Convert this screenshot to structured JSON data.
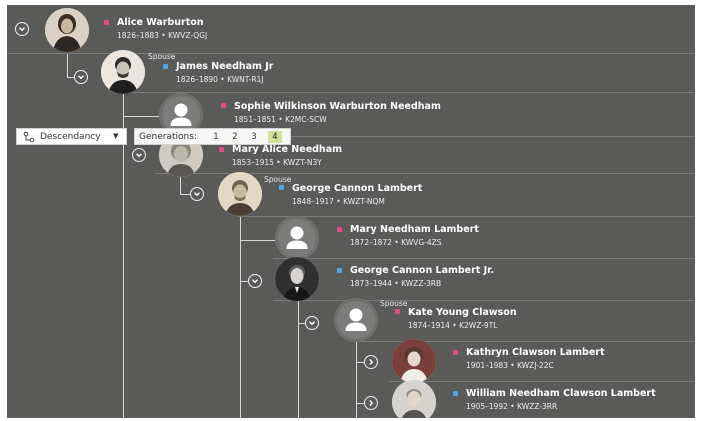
{
  "toolbar": {
    "view_label": "Descendancy",
    "view_caret": "▼",
    "generations_label": "Generations:",
    "generations": [
      "1",
      "2",
      "3",
      "4"
    ],
    "selected_generation": "4"
  },
  "spouse_label": "Spouse",
  "colors": {
    "female": "#e44a8a",
    "male": "#4aa8e8",
    "background": "#5a5a58"
  },
  "persons": [
    {
      "name": "Alice Warburton",
      "meta": "1826–1883 • KWVZ-QGJ",
      "sex": "female",
      "photo": "portrait-woman-icon"
    },
    {
      "name": "James Needham Jr",
      "meta": "1826–1890 • KWNT-R1J",
      "sex": "male",
      "photo": "portrait-man-icon"
    },
    {
      "name": "Sophie Wilkinson Warburton Needham",
      "meta": "1851–1851 • K2MC-SCW",
      "sex": "female",
      "photo": "silhouette-icon"
    },
    {
      "name": "Mary Alice Needham",
      "meta": "1853–1915 • KWZT-N3Y",
      "sex": "female",
      "photo": "portrait-woman-icon"
    },
    {
      "name": "George Cannon Lambert",
      "meta": "1848–1917 • KWZT-NQM",
      "sex": "male",
      "photo": "portrait-man-icon"
    },
    {
      "name": "Mary Needham Lambert",
      "meta": "1872–1872 • KWVG-4ZS",
      "sex": "female",
      "photo": "silhouette-icon"
    },
    {
      "name": "George Cannon Lambert Jr.",
      "meta": "1873–1944 • KWZZ-3RB",
      "sex": "male",
      "photo": "portrait-man-icon"
    },
    {
      "name": "Kate Young Clawson",
      "meta": "1874–1914 • K2WZ-9TL",
      "sex": "female",
      "photo": "silhouette-icon"
    },
    {
      "name": "Kathryn Clawson Lambert",
      "meta": "1901–1983 • KWZJ-22C",
      "sex": "female",
      "photo": "portrait-woman-icon"
    },
    {
      "name": "William Needham Clawson Lambert",
      "meta": "1905–1992 • KWZZ-3RR",
      "sex": "male",
      "photo": "portrait-man-icon"
    }
  ]
}
